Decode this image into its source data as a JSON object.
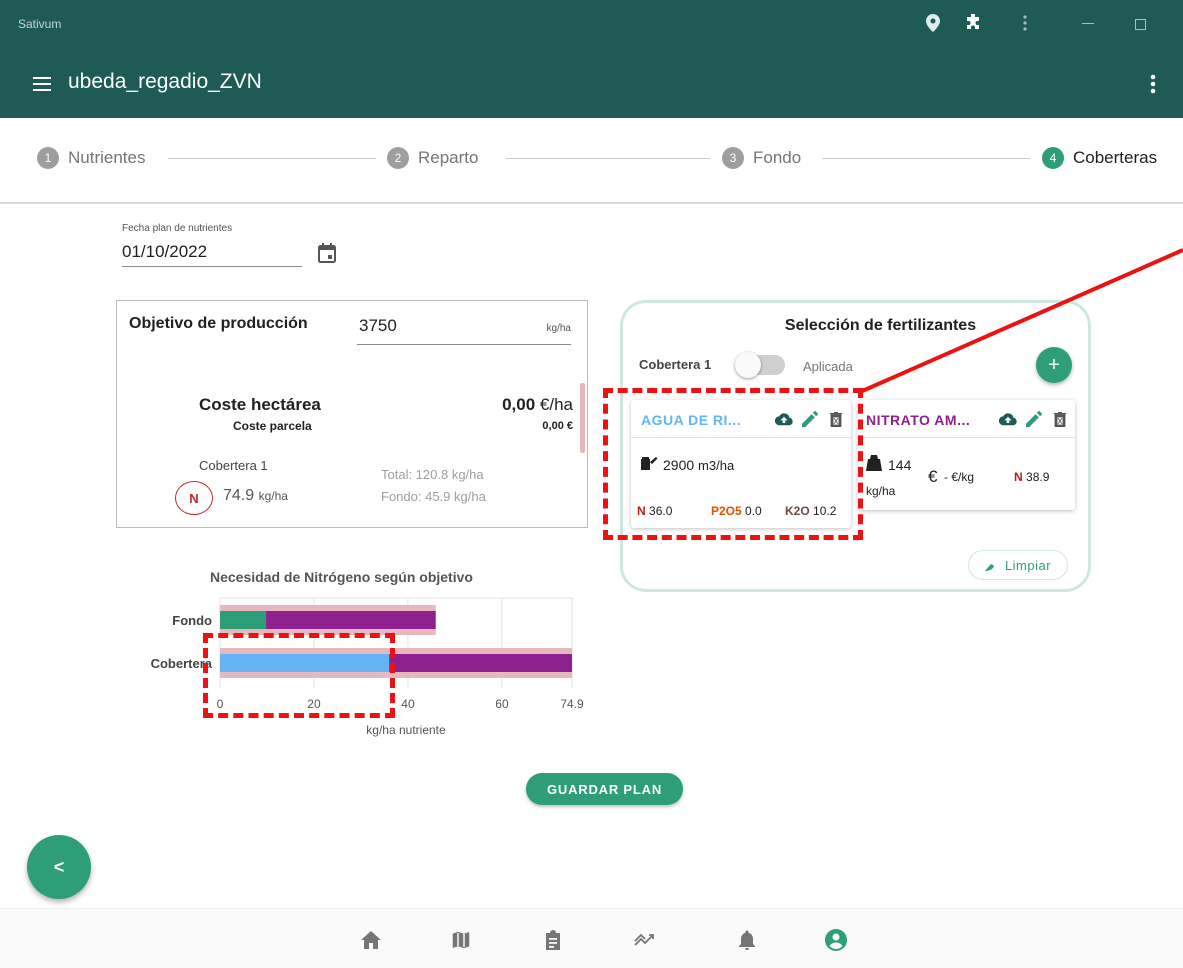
{
  "titlebar": {
    "app_title": "Sativum",
    "icons": [
      "location-icon",
      "puzzle-icon",
      "kebab-icon"
    ],
    "window_controls": [
      "minimize-icon",
      "maximize-icon"
    ]
  },
  "appbar": {
    "title": "ubeda_regadio_ZVN"
  },
  "stepper": {
    "steps": [
      {
        "num": "1",
        "label": "Nutrientes"
      },
      {
        "num": "2",
        "label": "Reparto"
      },
      {
        "num": "3",
        "label": "Fondo"
      },
      {
        "num": "4",
        "label": "Coberteras"
      }
    ],
    "active_index": 3
  },
  "date": {
    "label": "Fecha plan de nutrientes",
    "value": "01/10/2022"
  },
  "objective": {
    "title": "Objetivo de producción",
    "value": "3750",
    "unit": "kg/ha",
    "coste_hectarea_label": "Coste hectárea",
    "coste_hectarea_value": "0,00",
    "coste_hectarea_unit": "€/ha",
    "coste_parcela_label": "Coste parcela",
    "coste_parcela_value": "0,00 €",
    "cobertera_label": "Cobertera 1",
    "nutrient_badge": "N",
    "nutrient_value": "74.9",
    "nutrient_unit": "kg/ha",
    "total_label": "Total: 120.8 kg/ha",
    "fondo_label": "Fondo: 45.9 kg/ha"
  },
  "chart_data": {
    "type": "bar",
    "orientation": "horizontal",
    "stacked": true,
    "title": "Necesidad de Nitrógeno según objetivo",
    "xlabel": "kg/ha nutriente",
    "ylabel": "",
    "categories": [
      "Fondo",
      "Cobertera"
    ],
    "xticks": [
      "0",
      "20",
      "40",
      "60",
      "74.9"
    ],
    "xlim": [
      0,
      74.9
    ],
    "grid": true,
    "series": [
      {
        "values": [
          9.8,
          36.0
        ],
        "color": [
          "#2e9e78",
          "#64b5f6"
        ]
      },
      {
        "values": [
          36.1,
          38.9
        ],
        "color": "#8e2090"
      }
    ],
    "target": {
      "values": [
        45.9,
        74.9
      ],
      "color": "#e5b8bd"
    }
  },
  "fertilizers": {
    "title": "Selección de fertilizantes",
    "cobertera_label": "Cobertera 1",
    "aplicada_label": "Aplicada",
    "toggle_on": false,
    "add_label": "+",
    "limpiar_label": "Limpiar",
    "cards": [
      {
        "name": "AGUA DE RI...",
        "name_color": "#64b5f6",
        "amount": "2900",
        "amount_unit": "m3/ha",
        "n_label": "N",
        "n_value": "36.0",
        "p_label": "P2O5",
        "p_value": "0.0",
        "k_label": "K2O",
        "k_value": "10.2"
      },
      {
        "name": "NITRATO AM...",
        "name_color": "#8e2090",
        "amount": "144",
        "amount_unit": "kg/ha",
        "price": "- €/kg",
        "n_label": "N",
        "n_value": "38.9"
      }
    ]
  },
  "save_label": "GUARDAR PLAN",
  "back_label": "<",
  "colors": {
    "primary_dark": "#1e5a56",
    "accent": "#2e9e78",
    "highlight": "#ee1111"
  }
}
